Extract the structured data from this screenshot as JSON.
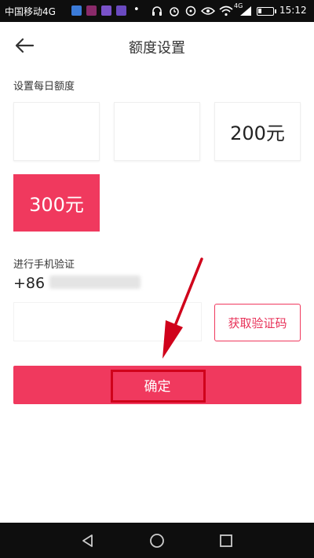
{
  "status_bar": {
    "carrier": "中国移动4G",
    "network_badge": "4G",
    "time": "15:12",
    "icons": [
      "app-notification-icon",
      "headphones-icon",
      "alarm-icon",
      "eye-icon",
      "wifi-icon",
      "signal-icon",
      "battery-icon"
    ]
  },
  "header": {
    "title": "额度设置",
    "back_icon": "back-arrow-icon"
  },
  "daily_limit": {
    "label": "设置每日额度",
    "options": [
      {
        "label": "",
        "selected": false
      },
      {
        "label": "",
        "selected": false
      },
      {
        "label": "200元",
        "selected": false
      },
      {
        "label": "300元",
        "selected": true
      }
    ]
  },
  "verification": {
    "label": "进行手机验证",
    "country_code": "+86",
    "code_input_placeholder": "",
    "get_code_button": "获取验证码"
  },
  "confirm_button": "确定",
  "annotation": {
    "color": "#d0021b"
  },
  "colors": {
    "accent": "#f0395e",
    "status_bar": "#0e0e0e"
  },
  "nav_bar": {
    "icons": [
      "back-triangle-icon",
      "home-circle-icon",
      "recents-square-icon"
    ]
  }
}
